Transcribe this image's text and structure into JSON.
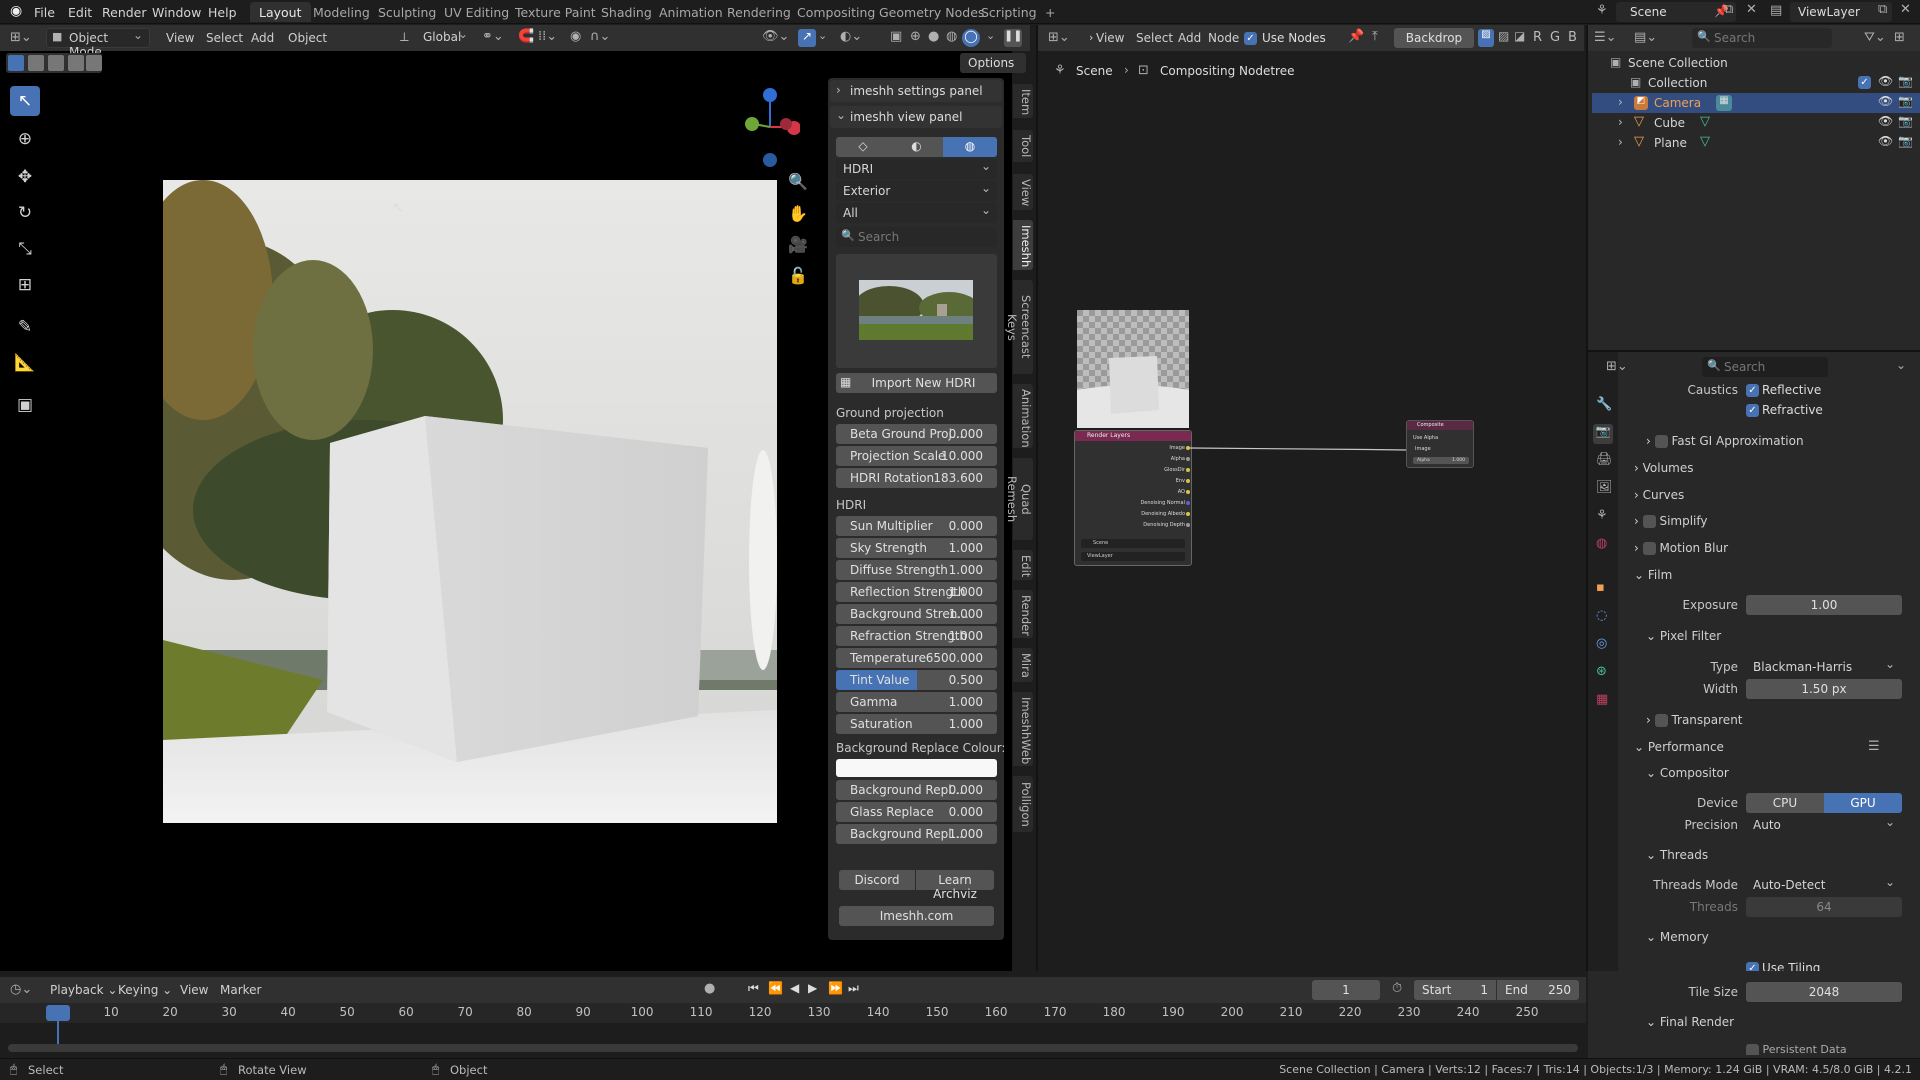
{
  "topbar": {
    "menus": [
      "File",
      "Edit",
      "Render",
      "Window",
      "Help"
    ],
    "workspaces": [
      "Layout",
      "Modeling",
      "Sculpting",
      "UV Editing",
      "Texture Paint",
      "Shading",
      "Animation",
      "Rendering",
      "Compositing",
      "Geometry Nodes",
      "Scripting"
    ],
    "active_workspace": "Layout",
    "add_tab": "+",
    "scene_label": "Scene",
    "view_layer_label": "ViewLayer"
  },
  "viewport_header": {
    "mode": "Object Mode",
    "menus": [
      "View",
      "Select",
      "Add",
      "Object"
    ],
    "transform": "Global",
    "options": "Options"
  },
  "imeshh": {
    "settings_panel": "imeshh settings panel",
    "view_panel": "imeshh view panel",
    "category": "HDRI",
    "subcategory": "Exterior",
    "filter": "All",
    "search_placeholder": "Search",
    "import_button": "Import New HDRI",
    "ground_projection_label": "Ground projection",
    "ground_rows": [
      {
        "label": "Beta Ground Proj...",
        "value": "0.000"
      },
      {
        "label": "Projection Scale",
        "value": "10.000"
      },
      {
        "label": "HDRI Rotation",
        "value": "183.600"
      }
    ],
    "hdri_label": "HDRI",
    "hdri_rows": [
      {
        "label": "Sun Multiplier",
        "value": "0.000"
      },
      {
        "label": "Sky Strength",
        "value": "1.000"
      },
      {
        "label": "Diffuse Strength",
        "value": "1.000"
      },
      {
        "label": "Reflection Strength",
        "value": "1.000"
      },
      {
        "label": "Background Stren...",
        "value": "1.000"
      },
      {
        "label": "Refraction Strength",
        "value": "1.000"
      },
      {
        "label": "Temperature",
        "value": "6500.000"
      },
      {
        "label": "Tint Value",
        "value": "0.500"
      },
      {
        "label": "Gamma",
        "value": "1.000"
      },
      {
        "label": "Saturation",
        "value": "1.000"
      }
    ],
    "tint_fraction": 0.5,
    "bg_replace_label": "Background Replace Colour:",
    "replace_rows": [
      {
        "label": "Background Repl...",
        "value": "0.000"
      },
      {
        "label": "Glass Replace",
        "value": "0.000"
      },
      {
        "label": "Background Repl...",
        "value": "1.000"
      }
    ],
    "discord_button": "Discord",
    "learn_button": "Learn Archviz",
    "site_button": "Imeshh.com"
  },
  "side_tabs": [
    "Item",
    "Tool",
    "View",
    "Imeshh",
    "Screencast Keys",
    "Animation",
    "Quad Remesh",
    "Edit",
    "Render",
    "Mira",
    "ImeshhWeb",
    "Polligon"
  ],
  "active_side_tab": "Imeshh",
  "compositor": {
    "menus": [
      "View",
      "Select",
      "Add",
      "Node"
    ],
    "use_nodes": "Use Nodes",
    "backdrop": "Backdrop",
    "channels": [
      "R",
      "G",
      "B"
    ],
    "breadcrumb_scene": "Scene",
    "breadcrumb_tree": "Compositing Nodetree",
    "render_layers_node": {
      "title": "Render Layers",
      "outputs": [
        "Image",
        "Alpha",
        "GlossDir",
        "Env",
        "AO",
        "Denoising Normal",
        "Denoising Albedo",
        "Denoising Depth"
      ],
      "scene": "Scene",
      "view_layer": "ViewLayer"
    },
    "composite_node": {
      "title": "Composite",
      "use_alpha": "Use Alpha",
      "image": "Image",
      "alpha": "Alpha",
      "alpha_value": "1.000"
    }
  },
  "outliner": {
    "search_placeholder": "Search",
    "root": "Scene Collection",
    "collection": "Collection",
    "items": [
      "Camera",
      "Cube",
      "Plane"
    ],
    "selected": "Camera"
  },
  "properties": {
    "search_placeholder": "Search",
    "caustics_label": "Caustics",
    "reflective": "Reflective",
    "refractive": "Refractive",
    "fast_gi": "Fast GI Approximation",
    "volumes": "Volumes",
    "curves": "Curves",
    "simplify": "Simplify",
    "motion_blur": "Motion Blur",
    "film": "Film",
    "exposure_label": "Exposure",
    "exposure_value": "1.00",
    "pixel_filter": "Pixel Filter",
    "type_label": "Type",
    "type_value": "Blackman-Harris",
    "width_label": "Width",
    "width_value": "1.50 px",
    "transparent": "Transparent",
    "performance": "Performance",
    "compositor": "Compositor",
    "device_label": "Device",
    "device_cpu": "CPU",
    "device_gpu": "GPU",
    "precision_label": "Precision",
    "precision_value": "Auto",
    "threads": "Threads",
    "threads_mode_label": "Threads Mode",
    "threads_mode_value": "Auto-Detect",
    "threads_label": "Threads",
    "threads_value": "64",
    "memory": "Memory",
    "use_tiling": "Use Tiling",
    "tile_size_label": "Tile Size",
    "tile_size_value": "2048",
    "final_render": "Final Render",
    "persistent_data": "Persistent Data"
  },
  "timeline": {
    "menus": [
      "Playback",
      "Keying",
      "View",
      "Marker"
    ],
    "current_frame": "1",
    "start_label": "Start",
    "start_value": "1",
    "end_label": "End",
    "end_value": "250",
    "ticks": [
      "1",
      "10",
      "20",
      "30",
      "40",
      "50",
      "60",
      "70",
      "80",
      "90",
      "100",
      "110",
      "120",
      "130",
      "140",
      "150",
      "160",
      "170",
      "180",
      "190",
      "200",
      "210",
      "220",
      "230",
      "240",
      "250"
    ]
  },
  "statusbar": {
    "select": "Select",
    "rotate": "Rotate View",
    "object": "Object",
    "info": "Scene Collection | Camera | Verts:12 | Faces:7 | Tris:14 | Objects:1/3 | Memory: 1.24 GiB | VRAM: 4.5/8.0 GiB | 4.2.1"
  },
  "colors": {
    "accent": "#4772b3",
    "header": "#303030",
    "panel_bg": "#2b2b2b",
    "field": "#545454"
  }
}
